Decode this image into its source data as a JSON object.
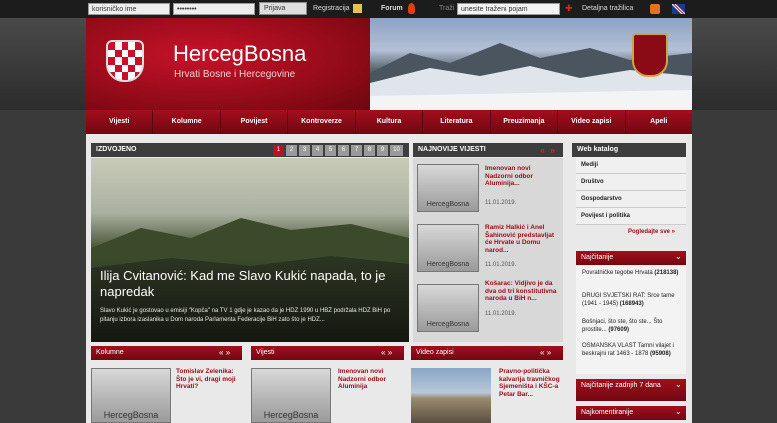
{
  "topbar": {
    "username_placeholder": "korisničko ime",
    "password_placeholder": "••••••••",
    "login_label": "Prijava",
    "register_label": "Registracija",
    "forum_label": "Forum",
    "search_label": "Traži",
    "search_placeholder": "unesite traženi pojam",
    "advanced_search_label": "Detaljna tražilica"
  },
  "header": {
    "title": "HercegBosna",
    "subtitle": "Hrvati Bosne i Hercegovine"
  },
  "nav": {
    "items": [
      "Vijesti",
      "Kolumne",
      "Povijest",
      "Kontroverze",
      "Kultura",
      "Literatura",
      "Preuzimanja",
      "Video zapisi",
      "Apeli"
    ]
  },
  "featured": {
    "heading": "IZDVOJENO",
    "pages": [
      "1",
      "2",
      "3",
      "4",
      "5",
      "6",
      "7",
      "8",
      "9",
      "10"
    ],
    "headline": "Ilija Cvitanović: Kad me Slavo Kukić napada, to je napredak",
    "summary": "Slavo Kukić je gostovao u emisiji \"Kopča\" na TV 1 gdje je kazao da je HDZ 1990 u HBŽ podržala HDZ BiH po pitanju izbora izaslanika u Dom naroda Parlamenta Federacije BiH zato što je HDZ..."
  },
  "latest": {
    "heading": "NAJNOVIJE VIJESTI",
    "logo_text": "HercegBosna",
    "items": [
      {
        "title": "Imenovan novi Nadzorni odbor Aluminija...",
        "date": "11.01.2019."
      },
      {
        "title": "Ramiz Halkić i Anel Šahinović predstavljat će Hrvate u Domu narod...",
        "date": "11.01.2019."
      },
      {
        "title": "Košarac: Vidjivo je da dva od tri konstitutivna naroda u BiH n...",
        "date": "11.01.2019."
      }
    ]
  },
  "sections": {
    "kolumne": {
      "heading": "Kolumne",
      "logo_text": "HercegBosna",
      "item": "Tomislav Zelenika: Što je vi, dragi moji Hrvati?"
    },
    "vijesti": {
      "heading": "Vijesti",
      "logo_text": "HercegBosna",
      "item": "Imenovan novi Nadzorni odbor Aluminija"
    },
    "video": {
      "heading": "Video zapisi",
      "item": "Pravno-politička kalvarija travničkog Sjemeništa i KŠC-a Petar Bar..."
    }
  },
  "sidebar": {
    "catalog_heading": "Web katalog",
    "catalog_items": [
      "Mediji",
      "Društvo",
      "Gospodarstvo",
      "Povijest i politika"
    ],
    "see_all": "Pogledajte sve »",
    "read_heading": "Najčitanije",
    "read_items": [
      {
        "title": "Povratničke tegobe Hrvata",
        "count": "(218138)"
      },
      {
        "title": "DRUGI SVJETSKI RAT: Srce tame (1941 - 1945)",
        "count": "(168943)"
      },
      {
        "title": "Bošnjaci, što ste, što ste... Što prostite...",
        "count": "(97609)"
      },
      {
        "title": "OSMANSKA VLAST Tamni vilajet i beskrajni rat 1463 - 1878",
        "count": "(95908)"
      }
    ],
    "read7_heading": "Najčitanije zadnjih 7 dana",
    "comments_heading": "Najkomentiranije"
  },
  "colors": {
    "brand_red": "#a30e1c",
    "dark": "#1c1c1c"
  },
  "arrows": {
    "prev": "«",
    "next": "»"
  }
}
